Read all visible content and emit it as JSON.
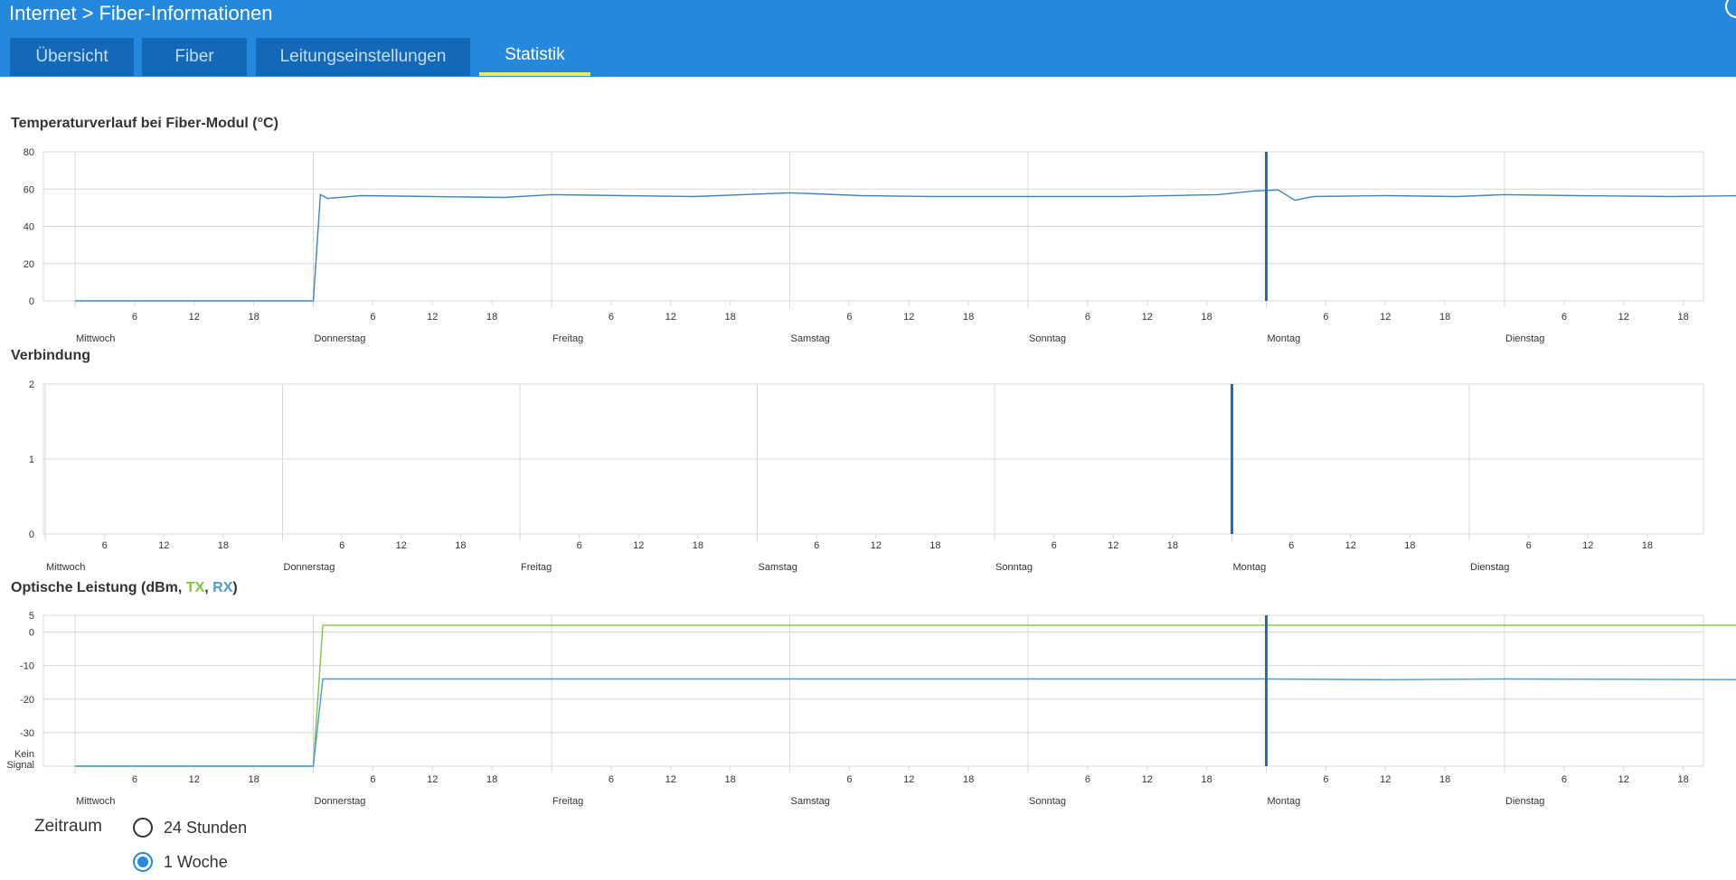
{
  "header": {
    "breadcrumb": [
      "Internet",
      "Fiber-Informationen"
    ],
    "breadcrumb_separator": ">"
  },
  "tabs": [
    {
      "label": "Übersicht",
      "active": false
    },
    {
      "label": "Fiber",
      "active": false
    },
    {
      "label": "Leitungseinstellungen",
      "active": false
    },
    {
      "label": "Statistik",
      "active": true
    }
  ],
  "colors": {
    "header_bg": "#2488dd",
    "tab_bg": "#1468b8",
    "tab_active_underline": "#f1ec55",
    "series_blue": "#3b86c8",
    "series_green": "#82c341",
    "grid": "#d8d8d8",
    "marker": "#1f6fb5"
  },
  "days": [
    "Mittwoch",
    "Donnerstag",
    "Freitag",
    "Samstag",
    "Sonntag",
    "Montag",
    "Dienstag"
  ],
  "hour_ticks": [
    "6",
    "12",
    "18"
  ],
  "chart_data": [
    {
      "type": "line",
      "title": "Temperaturverlauf bei Fiber-Modul (°C)",
      "y_ticks": [
        "80",
        "60",
        "40",
        "20",
        "0"
      ],
      "ylim": [
        0,
        80
      ],
      "grid": true,
      "marker_day": 5.0,
      "series": [
        {
          "color": "#3b86c8",
          "points": [
            [
              0,
              0
            ],
            [
              1.0,
              0
            ],
            [
              1.03,
              57
            ],
            [
              1.06,
              55
            ],
            [
              1.2,
              56.5
            ],
            [
              1.5,
              56
            ],
            [
              1.8,
              55.5
            ],
            [
              2.0,
              57
            ],
            [
              2.3,
              56.5
            ],
            [
              2.6,
              56
            ],
            [
              3.0,
              58
            ],
            [
              3.3,
              56.5
            ],
            [
              3.6,
              56
            ],
            [
              4.0,
              56
            ],
            [
              4.4,
              56
            ],
            [
              4.8,
              57
            ],
            [
              4.95,
              59
            ],
            [
              5.05,
              59.5
            ],
            [
              5.12,
              54
            ],
            [
              5.2,
              56
            ],
            [
              5.5,
              56.5
            ],
            [
              5.8,
              56
            ],
            [
              6.0,
              57
            ],
            [
              6.3,
              56.5
            ],
            [
              6.7,
              56
            ],
            [
              7.0,
              56.5
            ]
          ]
        }
      ]
    },
    {
      "type": "line",
      "title": "Verbindung",
      "y_ticks": [
        "2",
        "1",
        "0"
      ],
      "ylim": [
        0,
        2
      ],
      "grid": true,
      "marker_day": 5.0,
      "series": []
    },
    {
      "type": "line",
      "title_parts": {
        "prefix": "Optische Leistung (dBm, ",
        "tx": "TX",
        "sep": ", ",
        "rx": "RX",
        "suffix": ")"
      },
      "y_ticks": [
        "5",
        "0",
        "-10",
        "-20",
        "-30"
      ],
      "y_ticks_values": [
        5,
        0,
        -10,
        -20,
        -30
      ],
      "y_bottom_label": [
        "Kein",
        "Signal"
      ],
      "ylim": [
        -40,
        5
      ],
      "grid": true,
      "marker_day": 5.0,
      "series": [
        {
          "name": "TX",
          "color": "#82c341",
          "points": [
            [
              0,
              -40
            ],
            [
              1.0,
              -40
            ],
            [
              1.04,
              2
            ],
            [
              7.0,
              2
            ]
          ]
        },
        {
          "name": "RX",
          "color": "#4a9bd9",
          "points": [
            [
              0,
              -40
            ],
            [
              1.0,
              -40
            ],
            [
              1.04,
              -14
            ],
            [
              5.0,
              -14
            ],
            [
              5.5,
              -14.2
            ],
            [
              6.0,
              -14
            ],
            [
              7.0,
              -14.2
            ]
          ]
        }
      ]
    }
  ],
  "zeitraum": {
    "label": "Zeitraum",
    "options": [
      {
        "label": "24 Stunden",
        "selected": false
      },
      {
        "label": "1 Woche",
        "selected": true
      }
    ]
  }
}
